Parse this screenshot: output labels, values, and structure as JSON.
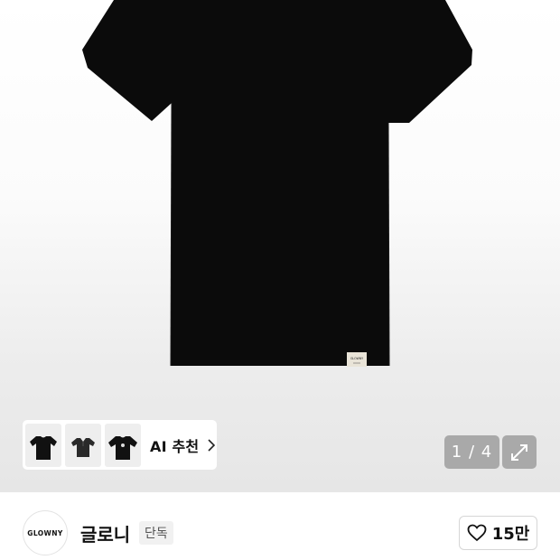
{
  "product": {
    "hero_image": "black-short-sleeve-tshirt-image",
    "image_counter": "1 / 4",
    "tag_text": "GLOWNY"
  },
  "ai_recommend": {
    "label": "AI 추천",
    "thumbnails": [
      "black-tshirt-thumb",
      "black-polo-thumb",
      "black-graphic-tee-thumb"
    ]
  },
  "brand": {
    "logo_text": "GLOWNY",
    "name": "글로니",
    "badge": "단독"
  },
  "like": {
    "count": "15만",
    "icon": "heart-outline-icon"
  },
  "colors": {
    "garment": "#0b0b0b",
    "counter_bg": "#a9a9a9",
    "badge_bg": "#f1f1f1"
  }
}
